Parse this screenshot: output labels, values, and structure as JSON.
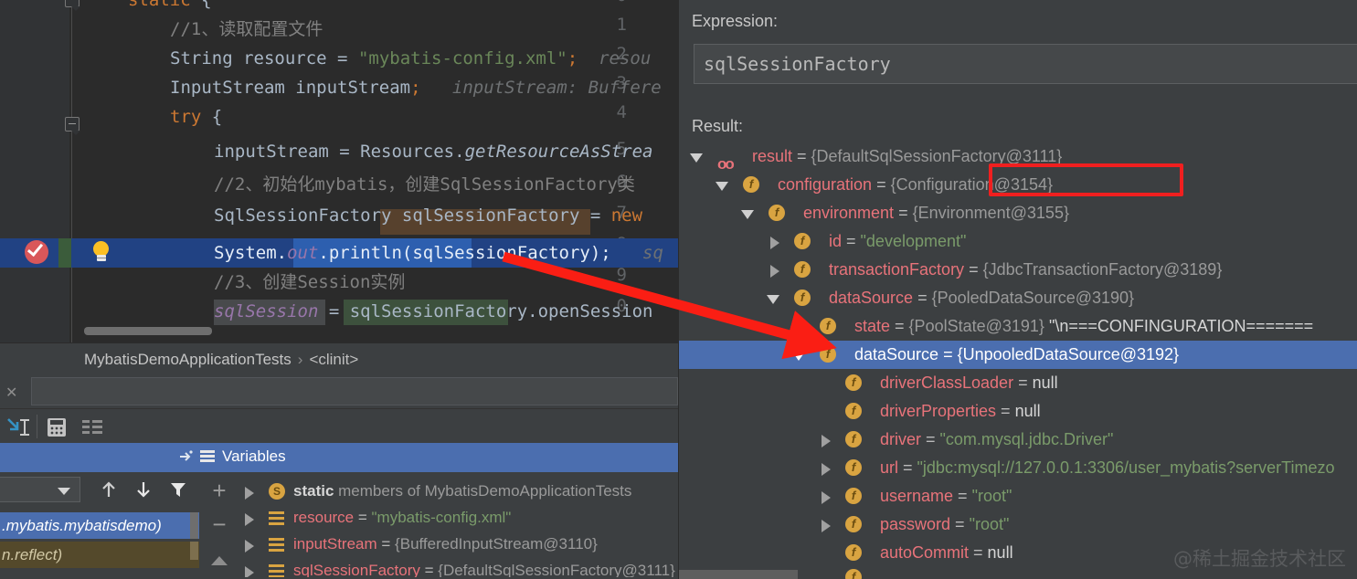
{
  "editor": {
    "line_numbers": [
      "0",
      "1",
      "2",
      "3",
      "4",
      "5",
      "6",
      "7",
      "8",
      "9",
      "0"
    ],
    "lines": [
      {
        "indent": 0,
        "text": "static {"
      },
      {
        "indent": 0,
        "text": "//1、读取配置文件"
      },
      {
        "indent": 0,
        "text": "String resource = \"mybatis-config.xml\";  resou"
      },
      {
        "indent": 0,
        "text": "InputStream inputStream;   inputStream: Buffere"
      },
      {
        "indent": 0,
        "text": "try {"
      },
      {
        "indent": 0,
        "text": "inputStream = Resources.getResourceAsStrea"
      },
      {
        "indent": 0,
        "text": "//2、初始化mybatis，创建SqlSessionFactory类"
      },
      {
        "indent": 0,
        "text": "SqlSessionFactory sqlSessionFactory = new"
      },
      {
        "indent": 0,
        "text": "System.out.println(sqlSessionFactory);   sq"
      },
      {
        "indent": 0,
        "text": "//3、创建Session实例"
      },
      {
        "indent": 0,
        "text": "sqlSession = sqlSessionFactory.openSession"
      }
    ],
    "tokens": {
      "kw_static": "static",
      "kw_try": "try",
      "kw_new": "new",
      "comment_1": "//1、读取配置文件",
      "comment_2": "//2、初始化mybatis，创建SqlSessionFactory类",
      "comment_3": "//3、创建Session实例",
      "type_string": "String",
      "var_resource": "resource",
      "str_config": "\"mybatis-config.xml\"",
      "hint_resource": "resou",
      "type_inputstream": "InputStream",
      "var_inputstream": "inputStream",
      "hint_inputstream": "inputStream: Buffere",
      "cls_resources": "Resources.",
      "mth_getresource": "getResourceAsStrea",
      "type_factory": "SqlSessionFactory",
      "var_factory": "sqlSessionFactory",
      "sysout_system": "System.",
      "sysout_out": "out",
      "sysout_println": ".println(",
      "sysout_arg": "sqlSessionFactory",
      "sysout_close": ");",
      "sysout_hint": "sq",
      "fld_sqlsession": "sqlSession",
      "assign_factory": "sqlSessionFactory.openSession"
    },
    "gutter_icons": {
      "breakpoint": "breakpoint-verified-icon",
      "intention": "intention-bulb-icon"
    }
  },
  "breadcrumb": {
    "class": "MybatisDemoApplicationTests",
    "separator": "›",
    "member": "<clinit>"
  },
  "search": {
    "value": "",
    "placeholder": "",
    "close_label": "✕"
  },
  "toolbar": {
    "icons": [
      {
        "name": "step-into-icon",
        "label": "Step Into"
      },
      {
        "name": "text-cursor-icon",
        "label": "Cursor"
      },
      {
        "name": "calculator-icon",
        "label": "Evaluate Expression"
      },
      {
        "name": "list-view-icon",
        "label": "List View"
      }
    ]
  },
  "variables_panel": {
    "tab_label": "Variables",
    "pin_icon": "pin-tab-icon",
    "list_icon": "variables-list-icon",
    "frames": {
      "toolbar_icons": [
        {
          "name": "thread-select-dropdown",
          "label": ""
        },
        {
          "name": "frame-up-arrow-icon",
          "label": "↑"
        },
        {
          "name": "frame-down-arrow-icon",
          "label": "↓"
        },
        {
          "name": "filter-funnel-icon",
          "label": "Filter"
        }
      ],
      "rows": [
        {
          "text": ".mybatis.mybatisdemo)",
          "selected": true
        },
        {
          "text": "n.reflect)",
          "selected": false
        }
      ]
    },
    "side_buttons": [
      {
        "name": "add-watch-button",
        "label": "+"
      },
      {
        "name": "remove-watch-button",
        "label": "−"
      },
      {
        "name": "scroll-up-button",
        "label": "▲"
      }
    ],
    "tree": [
      {
        "expander": "right",
        "badge": "s",
        "badge_type": "static",
        "indent": 38,
        "name": "static",
        "name_style": "static",
        "suffix": " members of MybatisDemoApplicationTests"
      },
      {
        "expander": "right",
        "badge": "stack",
        "badge_type": "stack",
        "indent": 38,
        "name": "resource",
        "name_style": "field",
        "eq": " = ",
        "value": "\"mybatis-config.xml\"",
        "value_style": "string"
      },
      {
        "expander": "right",
        "badge": "stack",
        "badge_type": "stack",
        "indent": 38,
        "name": "inputStream",
        "name_style": "field",
        "eq": " = ",
        "value": "{BufferedInputStream@3110}",
        "value_style": "ref"
      },
      {
        "expander": "right",
        "badge": "stack",
        "badge_type": "stack",
        "indent": 38,
        "name": "sqlSessionFactory",
        "name_style": "field",
        "eq": " = ",
        "value": "{DefaultSqlSessionFactory@3111}",
        "value_style": "ref"
      }
    ]
  },
  "evaluate_dialog": {
    "expression_label": "Expression:",
    "expression_value": "sqlSessionFactory",
    "result_label": "Result:",
    "result_tree": [
      {
        "depth": 0,
        "expander": "down",
        "badge": "oo",
        "name": "result",
        "eq": " = ",
        "value": "{DefaultSqlSessionFactory@3111}",
        "selected": false
      },
      {
        "depth": 1,
        "expander": "down",
        "badge": "f",
        "name": "configuration",
        "eq": " = ",
        "value": "{Configuration@3154}",
        "selected": false,
        "highlighted": true
      },
      {
        "depth": 2,
        "expander": "down",
        "badge": "f",
        "name": "environment",
        "eq": " = ",
        "value": "{Environment@3155}",
        "selected": false
      },
      {
        "depth": 3,
        "expander": "right",
        "badge": "f",
        "name": "id",
        "eq": " = ",
        "value": "\"development\"",
        "value_style": "string",
        "selected": false
      },
      {
        "depth": 3,
        "expander": "right",
        "badge": "f",
        "name": "transactionFactory",
        "eq": " = ",
        "value": "{JdbcTransactionFactory@3189}",
        "selected": false
      },
      {
        "depth": 3,
        "expander": "down",
        "badge": "f",
        "name": "dataSource",
        "eq": " = ",
        "value": "{PooledDataSource@3190}",
        "selected": false
      },
      {
        "depth": 4,
        "expander": "right",
        "badge": "f",
        "name": "state",
        "eq": " = ",
        "value": "{PoolState@3191} ",
        "extra": "\"\\n===CONFINGURATION=======",
        "selected": false
      },
      {
        "depth": 4,
        "expander": "down",
        "badge": "f",
        "name": "dataSource",
        "eq": " = ",
        "value": "{UnpooledDataSource@3192}",
        "selected": true
      },
      {
        "depth": 5,
        "expander": "none",
        "badge": "f",
        "name": "driverClassLoader",
        "eq": " = ",
        "value": "null",
        "value_style": "plain",
        "selected": false
      },
      {
        "depth": 5,
        "expander": "none",
        "badge": "f",
        "name": "driverProperties",
        "eq": " = ",
        "value": "null",
        "value_style": "plain",
        "selected": false
      },
      {
        "depth": 5,
        "expander": "right",
        "badge": "f",
        "name": "driver",
        "eq": " = ",
        "value": "\"com.mysql.jdbc.Driver\"",
        "value_style": "string",
        "selected": false
      },
      {
        "depth": 5,
        "expander": "right",
        "badge": "f",
        "name": "url",
        "eq": " = ",
        "value": "\"jdbc:mysql://127.0.0.1:3306/user_mybatis?serverTimezo",
        "value_style": "string",
        "selected": false
      },
      {
        "depth": 5,
        "expander": "right",
        "badge": "f",
        "name": "username",
        "eq": " = ",
        "value": "\"root\"",
        "value_style": "string",
        "selected": false
      },
      {
        "depth": 5,
        "expander": "right",
        "badge": "f",
        "name": "password",
        "eq": " = ",
        "value": "\"root\"",
        "value_style": "string",
        "selected": false
      },
      {
        "depth": 5,
        "expander": "none",
        "badge": "f",
        "name": "autoCommit",
        "eq": " = ",
        "value": "null",
        "value_style": "plain",
        "selected": false
      }
    ]
  },
  "annotations": {
    "red_box_target": "configuration",
    "red_arrow": {
      "from": "println-statement",
      "to": "dataSource-unpooled-row"
    }
  },
  "watermark": "@稀土掘金技术社区",
  "colors": {
    "editor_bg": "#2b2b2b",
    "panel_bg": "#3c3f41",
    "selection_blue": "#4b6eaf",
    "row_highlight": "#214283",
    "accent_red": "#f01f1f",
    "field_pink": "#e8737a",
    "string_green": "#6a8759",
    "keyword_orange": "#cc7832",
    "badge_gold": "#d9a441"
  }
}
